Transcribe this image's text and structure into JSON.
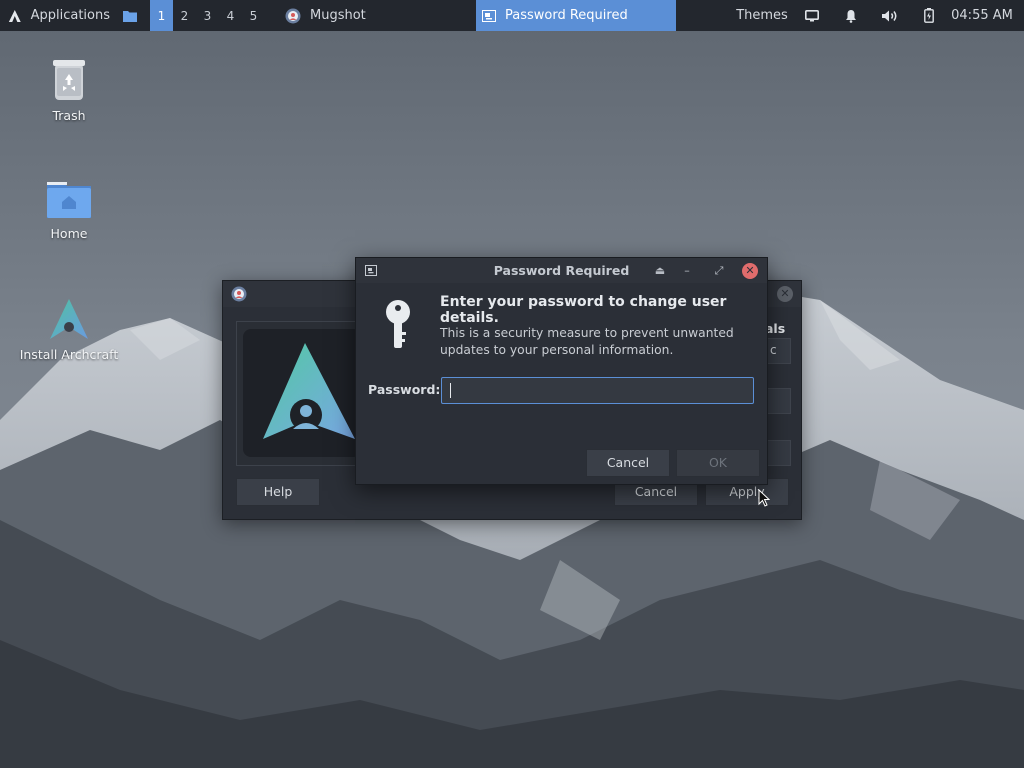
{
  "panel": {
    "applications_label": "Applications",
    "workspaces": [
      "1",
      "2",
      "3",
      "4",
      "5"
    ],
    "active_workspace": "1",
    "tasks": [
      {
        "label": "Mugshot",
        "icon": "mugshot-app-icon"
      },
      {
        "label": "Password Required",
        "icon": "dialog-window-icon",
        "active": true
      }
    ],
    "themes_label": "Themes",
    "clock": "04:55 AM",
    "tray_icons": [
      "display-icon",
      "bell-icon",
      "volume-icon",
      "battery-icon"
    ],
    "accent_color": "#5b8fd6"
  },
  "desktop": {
    "icons": [
      {
        "label": "Trash",
        "icon": "trash-icon"
      },
      {
        "label": "Home",
        "icon": "home-folder-icon"
      },
      {
        "label": "Install Archcraft",
        "icon": "archcraft-installer-icon"
      }
    ]
  },
  "mugshot": {
    "label_partial": "als",
    "field_partial": "c",
    "help_label": "Help",
    "cancel_label": "Cancel",
    "apply_label": "Apply"
  },
  "dialog": {
    "title": "Password Required",
    "heading": "Enter your password to change user details.",
    "body": "This is a security measure to prevent unwanted updates to your personal information.",
    "password_label": "Password:",
    "password_value": "",
    "cancel_label": "Cancel",
    "ok_label": "OK",
    "close_color": "#e06c6c"
  }
}
